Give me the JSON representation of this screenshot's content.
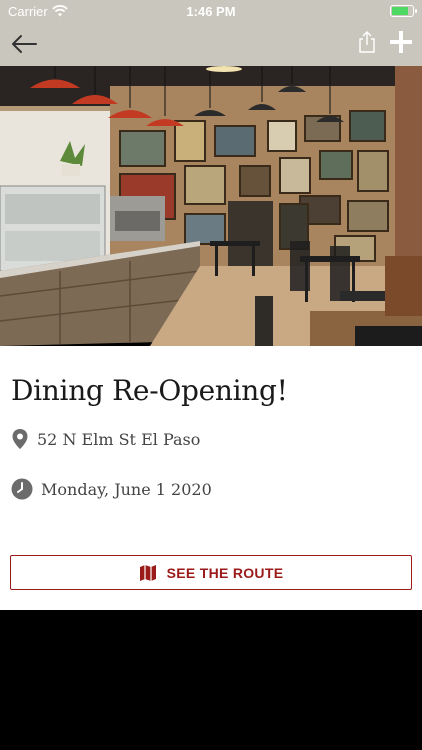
{
  "status_bar": {
    "carrier": "Carrier",
    "time": "1:46 PM",
    "battery_level": 0.85
  },
  "nav": {
    "back_icon": "arrow-left-icon",
    "share_icon": "share-icon",
    "add_icon": "plus-icon"
  },
  "event": {
    "title": "Dining Re-Opening!",
    "address": "52 N Elm St El Paso",
    "date": "Monday, June 1 2020",
    "location_icon": "map-pin-icon",
    "date_icon": "clock-icon"
  },
  "actions": {
    "route_label": "SEE THE ROUTE",
    "route_icon": "map-icon"
  },
  "colors": {
    "nav_bg": "#c9c6bd",
    "accent": "#9b1b1b",
    "icon_gray": "#6b6b6b"
  }
}
